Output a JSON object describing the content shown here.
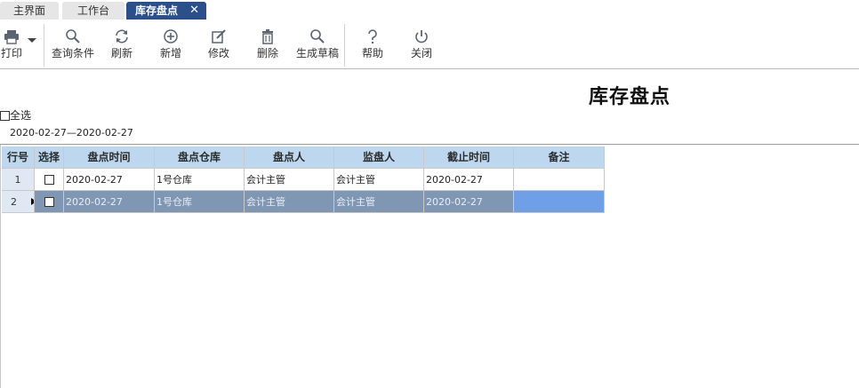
{
  "tabs": [
    {
      "label": "主界面"
    },
    {
      "label": "工作台"
    },
    {
      "label": "库存盘点",
      "close": "✕"
    }
  ],
  "toolbar": {
    "print": "打印",
    "query": "查询条件",
    "refresh": "刷新",
    "add": "新增",
    "edit": "修改",
    "delete": "删除",
    "generate": "生成草稿",
    "help": "帮助",
    "close": "关闭"
  },
  "icons": [
    "printer-icon",
    "dropdown-arrow-icon",
    "search-icon",
    "refresh-icon",
    "add-circle-icon",
    "edit-icon",
    "trash-icon",
    "search-icon",
    "help-icon",
    "power-icon"
  ],
  "page": {
    "title": "库存盘点",
    "select_all": "全选",
    "date_range": "2020-02-27—2020-02-27"
  },
  "table": {
    "headers": [
      "行号",
      "选择",
      "盘点时间",
      "盘点仓库",
      "盘点人",
      "监盘人",
      "截止时间",
      "备注"
    ],
    "rows": [
      {
        "no": "1",
        "time": "2020-02-27",
        "warehouse": "1号仓库",
        "counter": "会计主管",
        "supervisor": "会计主管",
        "deadline": "2020-02-27",
        "note": ""
      },
      {
        "no": "2",
        "time": "2020-02-27",
        "warehouse": "1号仓库",
        "counter": "会计主管",
        "supervisor": "会计主管",
        "deadline": "2020-02-27",
        "note": ""
      }
    ]
  },
  "colors": {
    "active_tab": "#2a4f8a",
    "header_bg": "#bdd7ee",
    "selected_row": "#7f97b3",
    "selected_note": "#6f9fe6"
  }
}
